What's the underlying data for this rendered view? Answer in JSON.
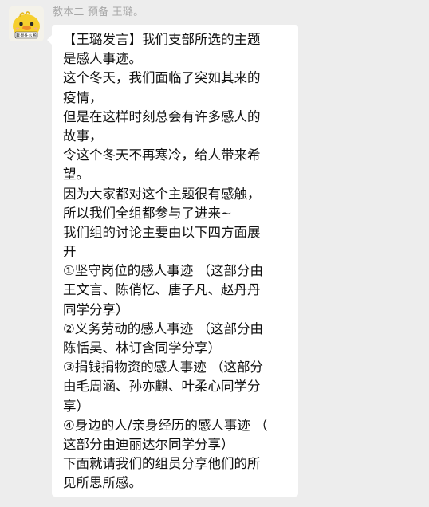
{
  "chat": {
    "sender_name": "教本二 预备 王璐。",
    "avatar_caption": "耗是什么鸭",
    "message_lines": [
      "【王璐发言】我们支部所选的主题",
      "是感人事迹。",
      "这个冬天，我们面临了突如其来的",
      "疫情，",
      "但是在这样时刻总会有许多感人的",
      "故事，",
      "令这个冬天不再寒冷，给人带来希",
      "望。",
      "因为大家都对这个主题很有感触，",
      "所以我们全组都参与了进来~",
      "我们组的讨论主要由以下四方面展",
      "开",
      "①坚守岗位的感人事迹 （这部分由",
      "王文言、陈俏忆、唐子凡、赵丹丹",
      "同学分享）",
      "②义务劳动的感人事迹 （这部分由",
      "陈恬昊、林订含同学分享）",
      "③捐钱捐物资的感人事迹 （这部分",
      "由毛周涵、孙亦麒、叶柔心同学分",
      "享）",
      "④身边的人/亲身经历的感人事迹 （",
      "这部分由迪丽达尔同学分享）",
      "下面就请我们的组员分享他们的所",
      "见所思所感。"
    ]
  }
}
